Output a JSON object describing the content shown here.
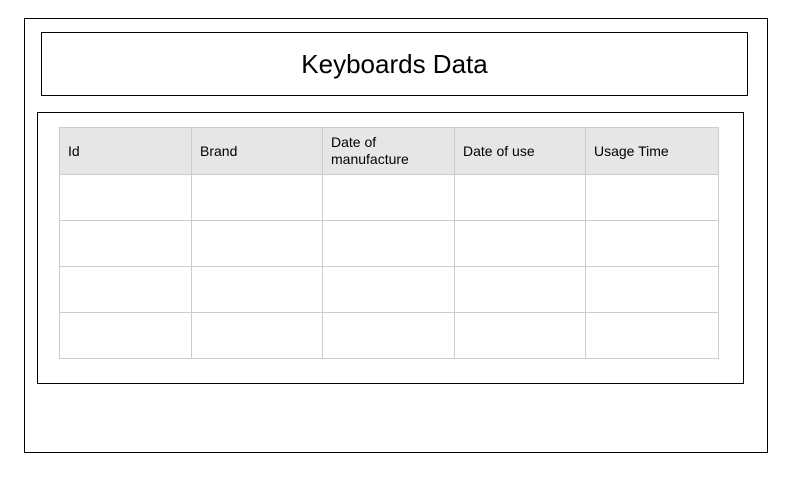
{
  "header": {
    "title": "Keyboards Data"
  },
  "table": {
    "columns": [
      "Id",
      "Brand",
      "Date of manufacture",
      "Date of use",
      "Usage Time"
    ],
    "rows": [
      [
        "",
        "",
        "",
        "",
        ""
      ],
      [
        "",
        "",
        "",
        "",
        ""
      ],
      [
        "",
        "",
        "",
        "",
        ""
      ],
      [
        "",
        "",
        "",
        "",
        ""
      ]
    ]
  },
  "colors": {
    "border": "#000000",
    "grid": "#cccccc",
    "header_bg": "#e6e6e6",
    "background": "#ffffff"
  }
}
